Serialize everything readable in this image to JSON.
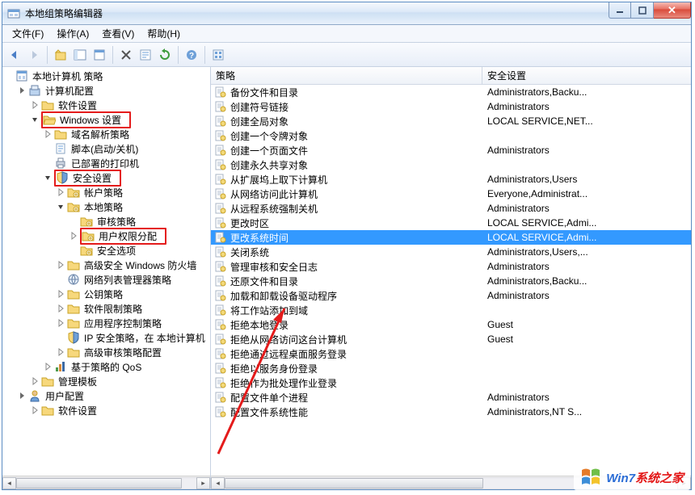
{
  "window": {
    "title": "本地组策略编辑器"
  },
  "menu": {
    "file": "文件(F)",
    "action": "操作(A)",
    "view": "查看(V)",
    "help": "帮助(H)"
  },
  "tree": {
    "root": "本地计算机 策略",
    "computer_config": "计算机配置",
    "software_settings": "软件设置",
    "windows_settings": "Windows 设置",
    "name_res": "域名解析策略",
    "scripts": "脚本(启动/关机)",
    "printers": "已部署的打印机",
    "security": "安全设置",
    "account_policy": "帐户策略",
    "local_policy": "本地策略",
    "audit_policy": "审核策略",
    "user_rights": "用户权限分配",
    "security_options": "安全选项",
    "adv_firewall": "高级安全 Windows 防火墙",
    "netlist": "网络列表管理器策略",
    "pubkey": "公钥策略",
    "software_restrict": "软件限制策略",
    "app_control": "应用程序控制策略",
    "ipsec": "IP 安全策略，在 本地计算机",
    "adv_audit": "高级审核策略配置",
    "qos": "基于策略的 QoS",
    "admin_templates": "管理模板",
    "user_config": "用户配置",
    "user_software": "软件设置"
  },
  "headers": {
    "policy": "策略",
    "setting": "安全设置"
  },
  "policies": [
    {
      "label": "备份文件和目录",
      "setting": "Administrators,Backu..."
    },
    {
      "label": "创建符号链接",
      "setting": "Administrators"
    },
    {
      "label": "创建全局对象",
      "setting": "LOCAL SERVICE,NET..."
    },
    {
      "label": "创建一个令牌对象",
      "setting": ""
    },
    {
      "label": "创建一个页面文件",
      "setting": "Administrators"
    },
    {
      "label": "创建永久共享对象",
      "setting": ""
    },
    {
      "label": "从扩展坞上取下计算机",
      "setting": "Administrators,Users"
    },
    {
      "label": "从网络访问此计算机",
      "setting": "Everyone,Administrat..."
    },
    {
      "label": "从远程系统强制关机",
      "setting": "Administrators"
    },
    {
      "label": "更改时区",
      "setting": "LOCAL SERVICE,Admi..."
    },
    {
      "label": "更改系统时间",
      "setting": "LOCAL SERVICE,Admi...",
      "selected": true
    },
    {
      "label": "关闭系统",
      "setting": "Administrators,Users,..."
    },
    {
      "label": "管理审核和安全日志",
      "setting": "Administrators"
    },
    {
      "label": "还原文件和目录",
      "setting": "Administrators,Backu..."
    },
    {
      "label": "加载和卸载设备驱动程序",
      "setting": "Administrators"
    },
    {
      "label": "将工作站添加到域",
      "setting": ""
    },
    {
      "label": "拒绝本地登录",
      "setting": "Guest"
    },
    {
      "label": "拒绝从网络访问这台计算机",
      "setting": "Guest"
    },
    {
      "label": "拒绝通过远程桌面服务登录",
      "setting": ""
    },
    {
      "label": "拒绝以服务身份登录",
      "setting": ""
    },
    {
      "label": "拒绝作为批处理作业登录",
      "setting": ""
    },
    {
      "label": "配置文件单个进程",
      "setting": "Administrators"
    },
    {
      "label": "配置文件系统性能",
      "setting": "Administrators,NT S..."
    }
  ],
  "watermark": {
    "part1": "Win7",
    "part2": "系统之家"
  },
  "scroll": {
    "left_thumb_width": 205,
    "right_thumb_width": 320
  }
}
